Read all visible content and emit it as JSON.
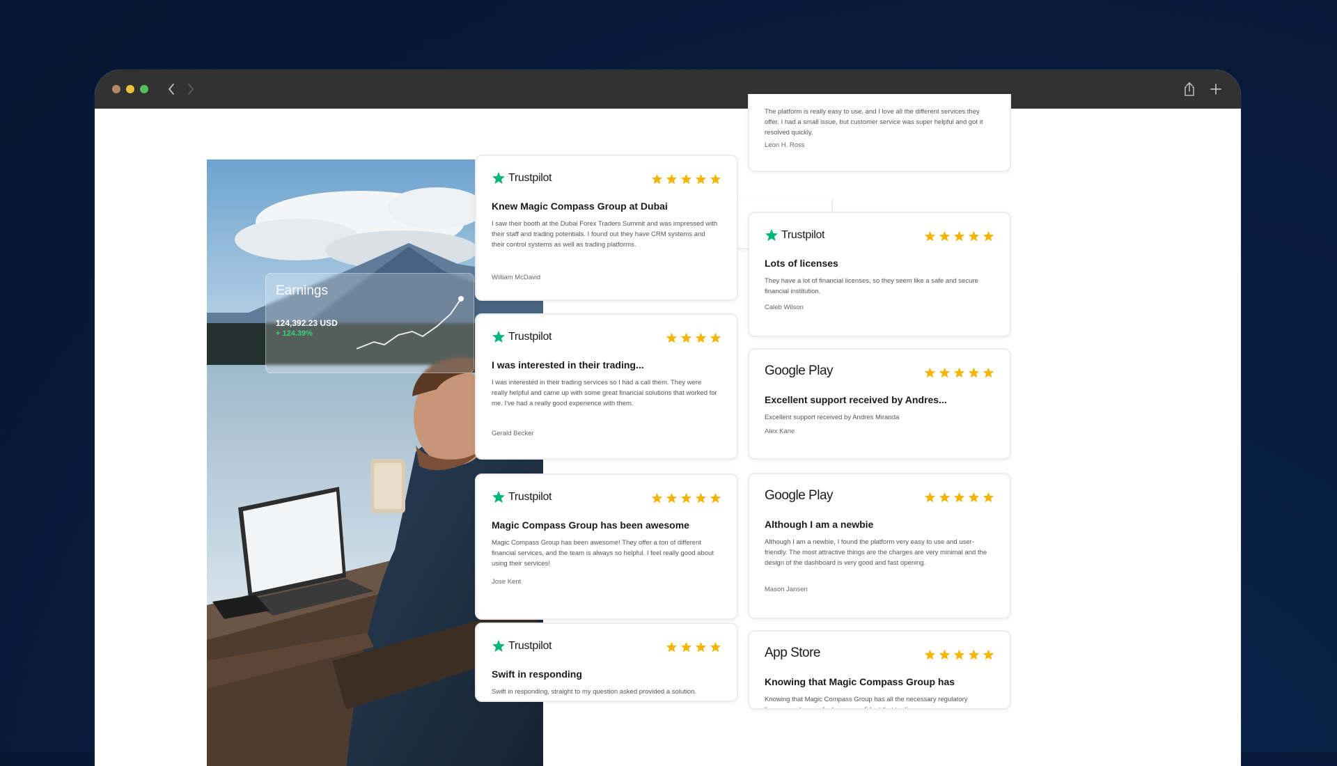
{
  "browser": {
    "icons": [
      "back-icon",
      "forward-icon",
      "share-icon",
      "plus-icon"
    ]
  },
  "hero": {
    "earnings_label": "Earnings",
    "amount": "124,392.23 USD",
    "change": "+ 124.39%"
  },
  "colors": {
    "accent_star": "#f4b400",
    "trustpilot_green": "#00b67a",
    "titlebar": "#323232"
  },
  "reviews": {
    "col1": [
      {
        "source": "Trustpilot",
        "stars": 5,
        "title": "Knew Magic Compass Group at Dubai",
        "body": "I saw their booth at the Dubai Forex Traders Summit and was impressed with their staff and trading potentials. I found out they have CRM systems and their control systems as well as trading platforms.",
        "author": "William McDavid"
      },
      {
        "source": "Trustpilot",
        "stars": 4,
        "title": "I was interested in their trading...",
        "body": "I was interested in their trading services so I had a call them. They were really helpful and came up with some great financial solutions that worked for me. I've had a really good experience with them.",
        "author": "Gerald Becker"
      },
      {
        "source": "Trustpilot",
        "stars": 5,
        "title": "Magic Compass Group has been awesome",
        "body": "Magic Compass Group has been awesome! They offer a ton of different financial services, and the team is always so helpful. I feel really good about using their services!",
        "author": "Jose Kent"
      },
      {
        "source": "Trustpilot",
        "stars": 4,
        "title": "Swift in responding",
        "body": "Swift in responding, straight to my question asked provided a solution.",
        "author": ""
      }
    ],
    "col2": [
      {
        "source": "",
        "stars": 0,
        "title": "",
        "body": "The platform is really easy to use, and I love all the different services they offer. I had a small issue, but customer service was super helpful and got it resolved quickly.",
        "author": "Leon H. Ross"
      },
      {
        "source": "Trustpilot",
        "stars": 5,
        "title": "Lots of licenses",
        "body": "They have a lot of financial licenses, so they seem like a safe and secure financial institution.",
        "author": "Caleb Wilson"
      },
      {
        "source": "Google Play",
        "stars": 5,
        "title": "Excellent support received by Andres...",
        "body": "Excellent support received by Andres Miranda",
        "author": "Alex Kane"
      },
      {
        "source": "Google Play",
        "stars": 5,
        "title": "Although I am a newbie",
        "body": "Although I am a newbie, I found the platform very easy to use and user-friendly. The most attractive things are the charges are very minimal and the design of the dashboard is very good and fast opening.",
        "author": "Mason Jansen"
      },
      {
        "source": "App Store",
        "stars": 5,
        "title": "Knowing that Magic Compass Group has",
        "body": "Knowing that Magic Compass Group has all the necessary regulatory licenses makes me feel super confident that trading",
        "author": ""
      }
    ]
  }
}
